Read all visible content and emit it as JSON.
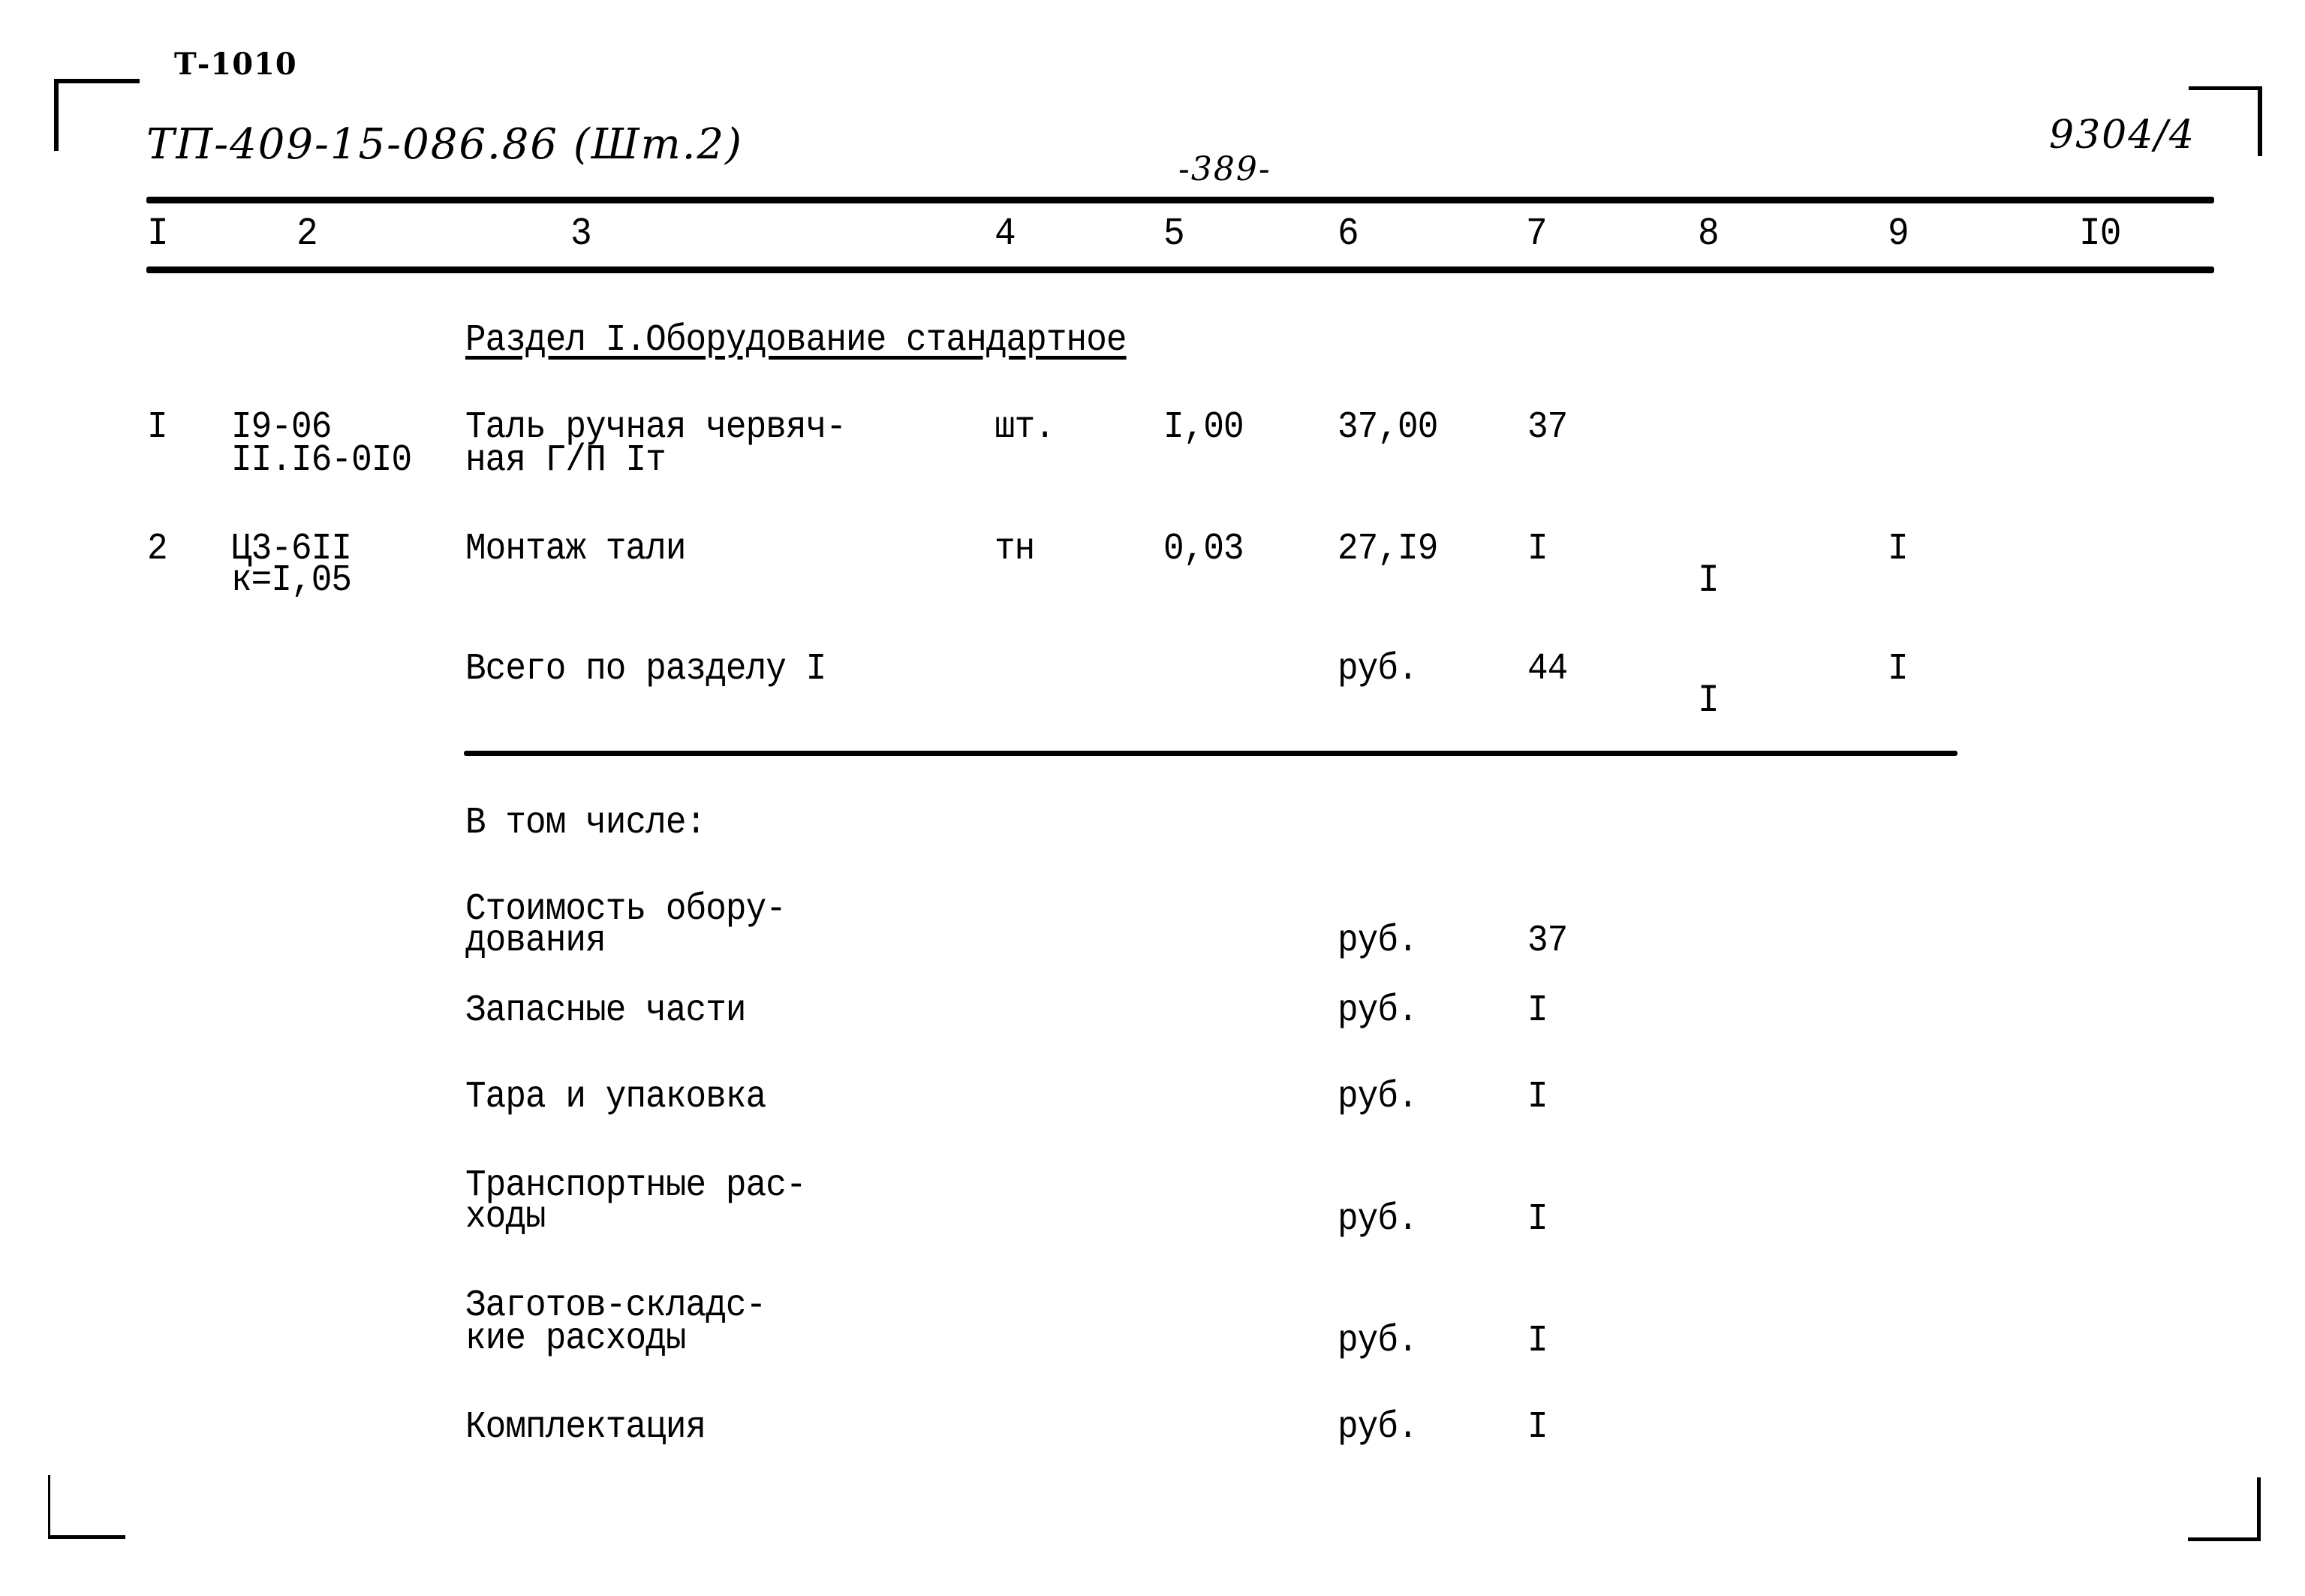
{
  "archive_stamp": "Т-1010",
  "document_code": "ТП-409-15-086.86 (Шт.2)",
  "page_number": "-389-",
  "sheet_number": "9304/4",
  "column_headers": [
    "I",
    "2",
    "3",
    "4",
    "5",
    "6",
    "7",
    "8",
    "9",
    "I0"
  ],
  "section": {
    "title": "Раздел I.Оборудование стандартное"
  },
  "rows": [
    {
      "num": "I",
      "code_line1": "I9-06",
      "code_line2": "II.I6-0I0",
      "name_line1": "Таль ручная червяч-",
      "name_line2": "ная Г/П Iт",
      "unit": "шт.",
      "quantity": "I,00",
      "unit_price": "37,00",
      "total": "37",
      "col8": "",
      "col9": ""
    },
    {
      "num": "2",
      "code_line1": "Ц3-6II",
      "code_line2": "к=I,05",
      "name_line1": "Монтаж тали",
      "name_line2": "",
      "unit": "тн",
      "quantity": "0,03",
      "unit_price": "27,I9",
      "total": "I",
      "col8": "I",
      "col9": "I"
    }
  ],
  "section_total": {
    "label": "Всего по разделу I",
    "unit": "руб.",
    "total": "44",
    "col8": "I",
    "col9": "I"
  },
  "breakdown": {
    "heading": "В том числе:",
    "items": [
      {
        "line1": "Стоимость обору-",
        "line2": "дования",
        "unit": "руб.",
        "value": "37"
      },
      {
        "line1": "Запасные части",
        "line2": "",
        "unit": "руб.",
        "value": "I"
      },
      {
        "line1": "Тара и упаковка",
        "line2": "",
        "unit": "руб.",
        "value": "I"
      },
      {
        "line1": "Транспортные рас-",
        "line2": "ходы",
        "unit": "руб.",
        "value": "I"
      },
      {
        "line1": "Заготов-складс-",
        "line2": "кие расходы",
        "unit": "руб.",
        "value": "I"
      },
      {
        "line1": "Комплектация",
        "line2": "",
        "unit": "руб.",
        "value": "I"
      }
    ]
  }
}
